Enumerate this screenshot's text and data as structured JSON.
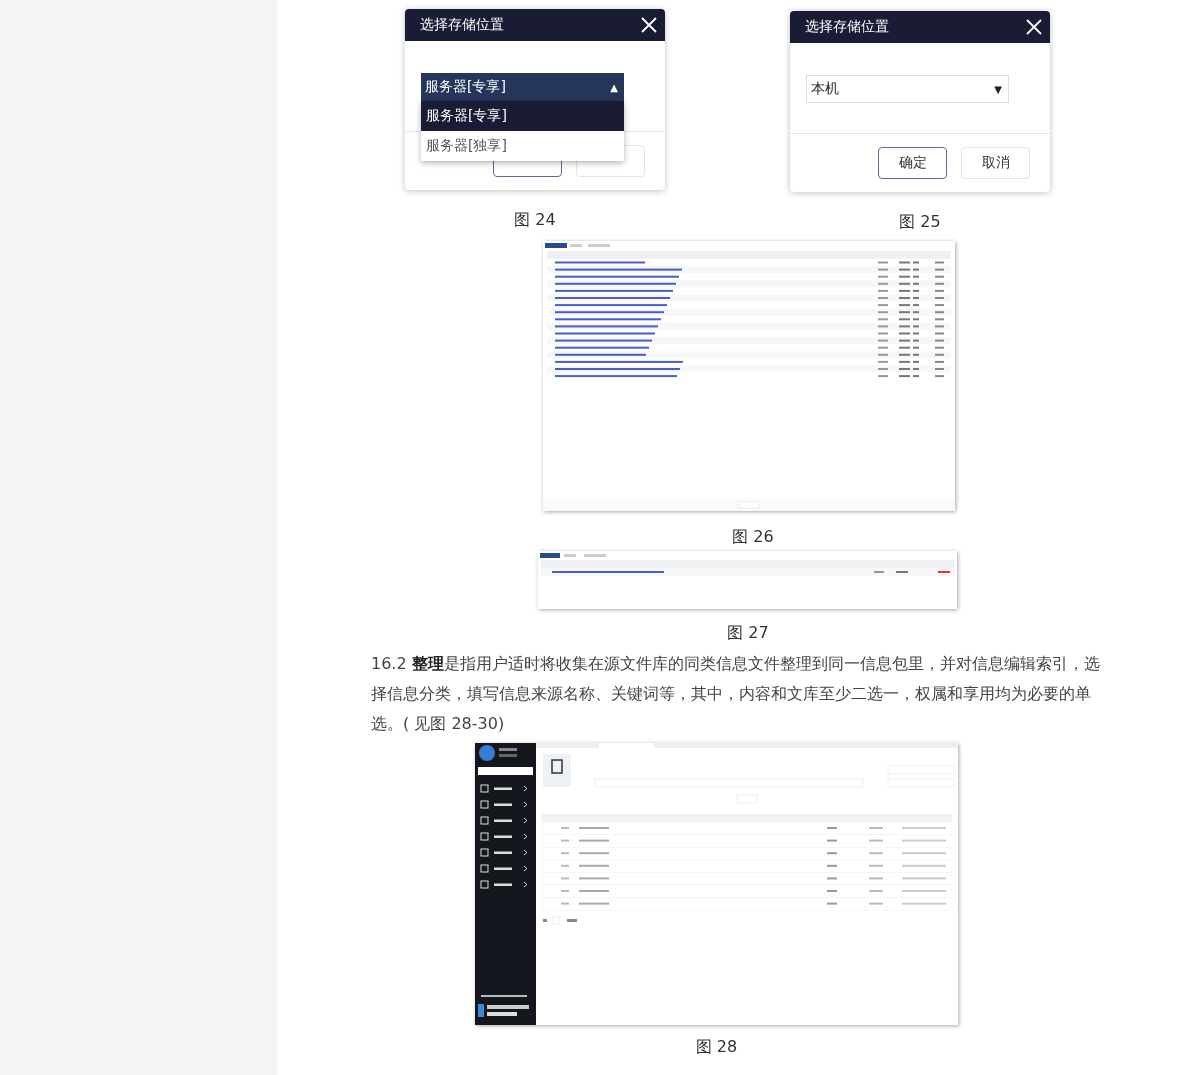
{
  "figures": [
    {
      "kind": "dialog",
      "title": "选择存储位置",
      "select": {
        "value": "服务器[专享]",
        "caret": "▲",
        "expanded": true,
        "options": [
          {
            "label": "服务器[专享]",
            "selected": true
          },
          {
            "label": "服务器[独享]",
            "selected": false
          }
        ]
      },
      "caption": "图 24"
    },
    {
      "kind": "dialog",
      "title": "选择存储位置",
      "select": {
        "value": "本机",
        "caret": "▼",
        "expanded": false
      },
      "buttons": [
        "确定",
        "取消"
      ],
      "caption": "图 25"
    },
    {
      "kind": "file-list",
      "caption": "图 26"
    },
    {
      "kind": "file-single",
      "caption": "图 27"
    },
    {
      "kind": "paragraph",
      "text": "16.2 **整理**是指用户适时将收集在源文件库的同类信息文件整理到同一信息包里，并对信息编辑索引，选择信息分类，填写信息来源名称、关键词等，其中，内容和文库至少二选一，权属和享用均为必要的单选。( 见图 28-30)"
    },
    {
      "kind": "app-screen",
      "caption": "图 28"
    }
  ]
}
